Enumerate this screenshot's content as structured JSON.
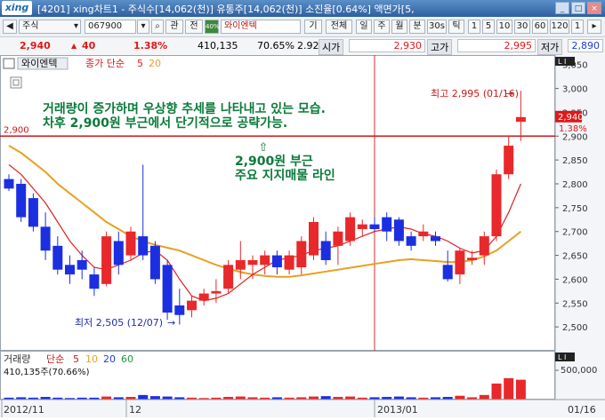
{
  "window": {
    "logo": "xing",
    "title": "[4201] xing차트1 - 주식수[14,062(천)] 유통주[14,062(천)] 소진율[0.64%] 액면가[5,",
    "buttons": [
      "_",
      "□",
      "×"
    ]
  },
  "toolbar": {
    "market": "주식",
    "code": "067900",
    "btn_rel": "관",
    "btn_all": "전",
    "badge": "40%",
    "stock_name": "와이엔텍",
    "btn_gi": "기",
    "view_all": "전체",
    "periods": [
      "일",
      "주",
      "월",
      "분",
      "30s",
      "틱"
    ],
    "numbers": [
      "1",
      "5",
      "10",
      "30",
      "60",
      "120",
      "1"
    ]
  },
  "quote": {
    "price": "2,940",
    "change": "40",
    "change_pct": "1.38%",
    "volume": "410,135",
    "vol_ratio": "70.65%",
    "turnover": "2.92%",
    "open_label": "시가",
    "open": "2,930",
    "high_label": "고가",
    "high": "2,995",
    "low_label": "저가",
    "low": "2,890"
  },
  "chart": {
    "stock_label": "와이엔텍",
    "indicator_label": "종가 단순",
    "ma_short": "5",
    "ma_long": "20",
    "price_axis": [
      "3,050",
      "3,000",
      "2,950",
      "2,900",
      "2,850",
      "2,800",
      "2,750",
      "2,700",
      "2,650",
      "2,600",
      "2,550",
      "2,500"
    ],
    "current_price_tag": "2,940",
    "current_pct_tag": "1.38%",
    "support_level": "2,900",
    "annotation_1": "거래량이 증가하며 우상향 추세를 나타내고 있는 모습.",
    "annotation_2": "차후 2,900원 부근에서 단기적으로 공략가능.",
    "annotation_3": "2,900원 부근",
    "annotation_4": "주요 지지매물 라인",
    "max_label": "최고 2,995 (01/16)",
    "min_label": "최저 2,505 (12/07)",
    "volume_label": "거래량",
    "volume_ma_label": "단순",
    "volume_ma": [
      "5",
      "10",
      "20",
      "60"
    ],
    "volume_value": "410,135주(70.66%)",
    "volume_axis": "500,000",
    "dates": [
      "2012/11",
      "12",
      "2013/01",
      "01/16"
    ],
    "colors": {
      "up": "#e8282a",
      "down": "#1c2fe0",
      "ma5": "#e02020",
      "ma20": "#e8a020",
      "annotation": "#0a7a3a"
    }
  },
  "chart_data": {
    "type": "candlestick",
    "ylim": [
      2450,
      3070
    ],
    "candles": [
      {
        "o": 2810,
        "h": 2820,
        "l": 2785,
        "c": 2790
      },
      {
        "o": 2800,
        "h": 2810,
        "l": 2720,
        "c": 2730
      },
      {
        "o": 2770,
        "h": 2780,
        "l": 2700,
        "c": 2710
      },
      {
        "o": 2710,
        "h": 2740,
        "l": 2640,
        "c": 2660
      },
      {
        "o": 2670,
        "h": 2690,
        "l": 2610,
        "c": 2620
      },
      {
        "o": 2630,
        "h": 2650,
        "l": 2590,
        "c": 2610
      },
      {
        "o": 2640,
        "h": 2660,
        "l": 2600,
        "c": 2620
      },
      {
        "o": 2610,
        "h": 2625,
        "l": 2565,
        "c": 2580
      },
      {
        "o": 2590,
        "h": 2700,
        "l": 2585,
        "c": 2690
      },
      {
        "o": 2680,
        "h": 2700,
        "l": 2610,
        "c": 2630
      },
      {
        "o": 2650,
        "h": 2710,
        "l": 2640,
        "c": 2700
      },
      {
        "o": 2690,
        "h": 2840,
        "l": 2640,
        "c": 2650
      },
      {
        "o": 2670,
        "h": 2680,
        "l": 2590,
        "c": 2600
      },
      {
        "o": 2630,
        "h": 2640,
        "l": 2515,
        "c": 2530
      },
      {
        "o": 2545,
        "h": 2580,
        "l": 2505,
        "c": 2525
      },
      {
        "o": 2535,
        "h": 2565,
        "l": 2520,
        "c": 2555
      },
      {
        "o": 2555,
        "h": 2580,
        "l": 2545,
        "c": 2570
      },
      {
        "o": 2570,
        "h": 2600,
        "l": 2550,
        "c": 2575
      },
      {
        "o": 2580,
        "h": 2640,
        "l": 2570,
        "c": 2630
      },
      {
        "o": 2620,
        "h": 2680,
        "l": 2600,
        "c": 2640
      },
      {
        "o": 2630,
        "h": 2650,
        "l": 2600,
        "c": 2640
      },
      {
        "o": 2630,
        "h": 2660,
        "l": 2610,
        "c": 2650
      },
      {
        "o": 2650,
        "h": 2660,
        "l": 2610,
        "c": 2625
      },
      {
        "o": 2620,
        "h": 2660,
        "l": 2610,
        "c": 2650
      },
      {
        "o": 2625,
        "h": 2690,
        "l": 2610,
        "c": 2680
      },
      {
        "o": 2650,
        "h": 2730,
        "l": 2640,
        "c": 2720
      },
      {
        "o": 2680,
        "h": 2700,
        "l": 2630,
        "c": 2640
      },
      {
        "o": 2670,
        "h": 2710,
        "l": 2630,
        "c": 2700
      },
      {
        "o": 2680,
        "h": 2740,
        "l": 2670,
        "c": 2730
      },
      {
        "o": 2705,
        "h": 2725,
        "l": 2690,
        "c": 2715
      },
      {
        "o": 2715,
        "h": 2730,
        "l": 2700,
        "c": 2705
      },
      {
        "o": 2730,
        "h": 2740,
        "l": 2680,
        "c": 2700
      },
      {
        "o": 2725,
        "h": 2730,
        "l": 2670,
        "c": 2680
      },
      {
        "o": 2690,
        "h": 2700,
        "l": 2660,
        "c": 2670
      },
      {
        "o": 2690,
        "h": 2715,
        "l": 2680,
        "c": 2700
      },
      {
        "o": 2690,
        "h": 2700,
        "l": 2670,
        "c": 2680
      },
      {
        "o": 2630,
        "h": 2660,
        "l": 2595,
        "c": 2600
      },
      {
        "o": 2610,
        "h": 2665,
        "l": 2590,
        "c": 2660
      },
      {
        "o": 2640,
        "h": 2660,
        "l": 2630,
        "c": 2645
      },
      {
        "o": 2650,
        "h": 2700,
        "l": 2630,
        "c": 2690
      },
      {
        "o": 2690,
        "h": 2830,
        "l": 2680,
        "c": 2820
      },
      {
        "o": 2820,
        "h": 2900,
        "l": 2810,
        "c": 2880
      },
      {
        "o": 2930,
        "h": 2995,
        "l": 2890,
        "c": 2940
      }
    ],
    "ma5": [
      2840,
      2820,
      2790,
      2760,
      2720,
      2680,
      2650,
      2625,
      2620,
      2630,
      2640,
      2655,
      2660,
      2640,
      2600,
      2565,
      2555,
      2560,
      2570,
      2590,
      2610,
      2625,
      2640,
      2645,
      2650,
      2660,
      2665,
      2670,
      2680,
      2690,
      2700,
      2705,
      2710,
      2705,
      2695,
      2690,
      2680,
      2665,
      2655,
      2660,
      2690,
      2740,
      2800
    ],
    "ma20": [
      2880,
      2865,
      2845,
      2825,
      2800,
      2780,
      2760,
      2740,
      2720,
      2705,
      2690,
      2680,
      2672,
      2666,
      2660,
      2650,
      2640,
      2630,
      2622,
      2615,
      2610,
      2607,
      2605,
      2605,
      2608,
      2612,
      2616,
      2620,
      2624,
      2628,
      2632,
      2636,
      2640,
      2642,
      2640,
      2638,
      2636,
      2636,
      2640,
      2648,
      2660,
      2680,
      2700
    ],
    "volume": [
      0.05,
      0.06,
      0.05,
      0.07,
      0.05,
      0.04,
      0.05,
      0.05,
      0.08,
      0.06,
      0.07,
      0.12,
      0.09,
      0.08,
      0.06,
      0.05,
      0.04,
      0.05,
      0.07,
      0.08,
      0.06,
      0.05,
      0.06,
      0.05,
      0.06,
      0.08,
      0.09,
      0.07,
      0.08,
      0.05,
      0.06,
      0.07,
      0.08,
      0.06,
      0.05,
      0.06,
      0.07,
      0.1,
      0.06,
      0.12,
      0.42,
      0.56,
      0.52
    ],
    "volume_max": 600000
  }
}
